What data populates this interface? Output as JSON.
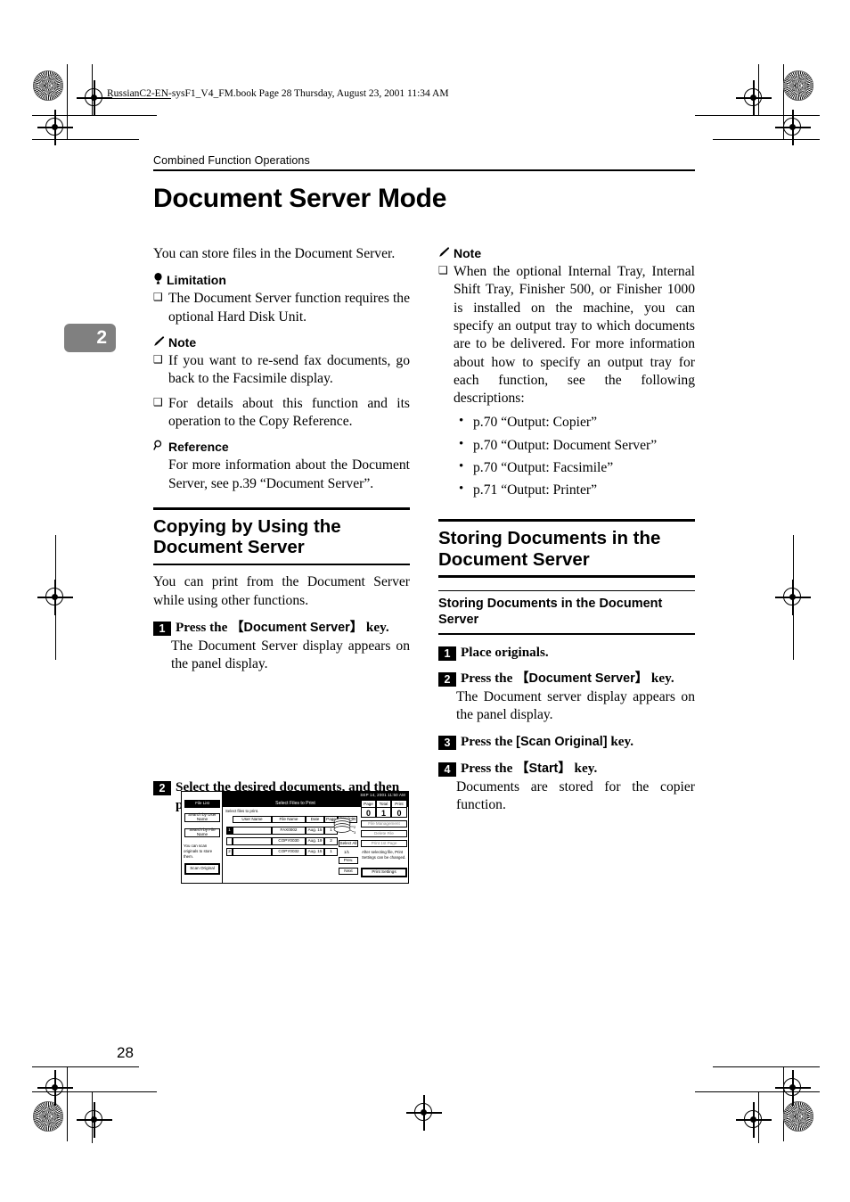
{
  "print_header": "RussianC2-EN-sysF1_V4_FM.book  Page 28  Thursday, August 23, 2001  11:34 AM",
  "running_head": "Combined Function Operations",
  "chapter_tab": "2",
  "page_number": "28",
  "title": "Document Server Mode",
  "left_column": {
    "intro": "You can store files in the Document Server.",
    "limitation_head": {
      "icon": "balloon-icon",
      "glyph": "♀",
      "label": "Limitation"
    },
    "limitation_items": [
      "The Document Server function requires the optional Hard Disk Unit."
    ],
    "note_head": {
      "icon": "pencil-icon",
      "glyph": "✎",
      "label": "Note"
    },
    "note_items": [
      "If you want to re-send fax documents, go back to the Facsimile display.",
      "For details about this function and its operation to the Copy Reference."
    ],
    "reference_head": {
      "icon": "magnifier-icon",
      "glyph": "⚲",
      "label": "Reference"
    },
    "reference_text": "For more information about the Document Server, see p.39 “Document Server”.",
    "section": {
      "heading": "Copying by Using the Document Server",
      "intro": "You can print from the Document Server while using other functions."
    },
    "steps": [
      {
        "num": "1",
        "text_pre": "Press the ",
        "text_key": "【Document Server】",
        "text_post": " key.",
        "body": "The Document Server display appears on the panel display."
      },
      {
        "num": "2",
        "text_pre": "Select the desired documents, and then press [OK].",
        "text_key": "",
        "text_post": "",
        "body": ""
      }
    ]
  },
  "right_column": {
    "note_head": {
      "icon": "pencil-icon",
      "glyph": "✎",
      "label": "Note"
    },
    "note_items": [
      "When the optional Internal Tray, Internal Shift Tray, Finisher 500, or Finisher 1000 is installed on the machine, you can specify an output tray to which documents are to be delivered. For more information about how to specify an output tray for each function, see the following descriptions:"
    ],
    "page_refs": [
      "p.70 “Output: Copier”",
      "p.70 “Output: Document Server”",
      "p.70 “Output: Facsimile”",
      "p.71 “Output: Printer”"
    ],
    "section": {
      "heading": "Storing Documents in the Document Server"
    },
    "subsection": {
      "heading": "Storing Documents in the Document Server"
    },
    "steps": [
      {
        "num": "1",
        "text_pre": "Place originals.",
        "text_key": "",
        "text_post": "",
        "body": ""
      },
      {
        "num": "2",
        "text_pre": "Press the ",
        "text_key": "【Document Server】",
        "text_post": " key.",
        "body": "The Document server display appears on the panel display."
      },
      {
        "num": "3",
        "text_pre": "Press the ",
        "text_key": "[Scan Original]",
        "text_post": " key.",
        "body": ""
      },
      {
        "num": "4",
        "text_pre": "Press the ",
        "text_key": "【Start】",
        "text_post": " key.",
        "body": "Documents are stored for the copier function."
      }
    ]
  },
  "panel_figure": {
    "status_bar": "SEP  14, 2001  11:50 AM",
    "title_bar": "Select Files to Print",
    "left_buttons": [
      "File List",
      "Search by User Name",
      "Search by File Name",
      "Scan Original"
    ],
    "left_note": "You can scan originals to store them.",
    "prompt": "Select files to print.",
    "table_headers": [
      "User Name",
      "File Name",
      "Date",
      "Page",
      "Print Order"
    ],
    "rows": [
      {
        "sel": "1",
        "user": "",
        "file": "FAX0002",
        "date": "Aug.  15",
        "page": "1"
      },
      {
        "sel": "",
        "user": "",
        "file": "COPY0030",
        "date": "Aug.  19",
        "page": "2"
      },
      {
        "sel": "2",
        "user": "",
        "file": "COPY0032",
        "date": "Aug.  15",
        "page": "1"
      }
    ],
    "counters": [
      {
        "label": "Page",
        "value": "0"
      },
      {
        "label": "Total",
        "value": "1"
      },
      {
        "label": "Print",
        "value": "0"
      }
    ],
    "right_buttons": [
      "File Management",
      "Delete File",
      "Print 1st Page"
    ],
    "right_note": "After selecting file, Print Settings can be changed.",
    "right_action": "Print Settings",
    "nav_buttons": [
      "Select All",
      "Prev.",
      "Next"
    ],
    "nav_counter": "1/1"
  }
}
